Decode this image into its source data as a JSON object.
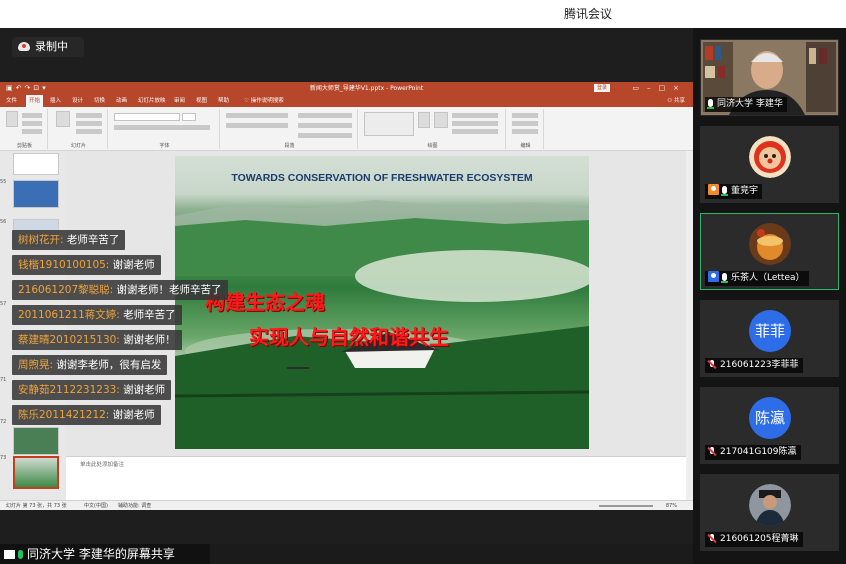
{
  "app": {
    "title": "腾讯会议"
  },
  "recording": {
    "label": "录制中"
  },
  "ppt": {
    "window_title": "新闻大师赏_导建华V1.pptx - PowerPoint",
    "login_label": "登录",
    "share_label": "共享",
    "tabs": [
      "文件",
      "开始",
      "插入",
      "设计",
      "切换",
      "动画",
      "幻灯片放映",
      "审阅",
      "视图",
      "帮助",
      "操作说明搜索"
    ],
    "active_tab": "开始",
    "ribbon_groups": [
      "剪贴板",
      "幻灯片",
      "字体",
      "段落",
      "绘图",
      "编辑"
    ],
    "thumb_numbers": [
      "55",
      "56",
      "57",
      "71",
      "72",
      "73"
    ],
    "notes_placeholder": "单击此处添加备注",
    "status": {
      "slide": "幻灯片 第 73 张，共 73 张",
      "lang": "中文(中国)",
      "access": "辅助功能: 调查",
      "zoom": "87%"
    }
  },
  "slide": {
    "heading": "TOWARDS CONSERVATION OF FRESHWATER ECOSYSTEM",
    "line1": "构建生态之魂",
    "line2": "实现人与自然和谐共生"
  },
  "chat": [
    {
      "sender": "树树花开:",
      "text": " 老师辛苦了"
    },
    {
      "sender": "钱楷1910100105:",
      "text": " 谢谢老师"
    },
    {
      "sender": "216061207黎聪聪:",
      "text": " 谢谢老师！老师辛苦了"
    },
    {
      "sender": "2011061211蒋文婷:",
      "text": " 老师辛苦了"
    },
    {
      "sender": "蔡建晴2010215130:",
      "text": " 谢谢老师！"
    },
    {
      "sender": "周煦晃:",
      "text": " 谢谢李老师，很有启发"
    },
    {
      "sender": "安静茹2112231233:",
      "text": " 谢谢老师"
    },
    {
      "sender": "陈乐2011421212:",
      "text": " 谢谢老师"
    }
  ],
  "sharer": {
    "label": "同济大学 李建华的屏幕共享"
  },
  "participants": [
    {
      "name": "同济大学 李建华",
      "type": "video",
      "mic": "on"
    },
    {
      "name": "董竞宇",
      "type": "image",
      "mic": "on"
    },
    {
      "name": "乐茶人（Lettea）",
      "type": "image",
      "mic": "on"
    },
    {
      "name": "216061223李菲菲",
      "type": "text",
      "avatar_text": "菲菲",
      "mic": "off"
    },
    {
      "name": "217041G109陈瀛",
      "type": "text",
      "avatar_text": "陈瀛",
      "mic": "off"
    },
    {
      "name": "216061205程菁琳",
      "type": "image",
      "mic": "off"
    }
  ],
  "colors": {
    "ppt_accent": "#b7472a",
    "avatar_blue": "#2d6ee8",
    "speaking_green": "#2fb36b",
    "slide_red": "#ff1a1a",
    "chat_sender": "#f0a33a"
  }
}
